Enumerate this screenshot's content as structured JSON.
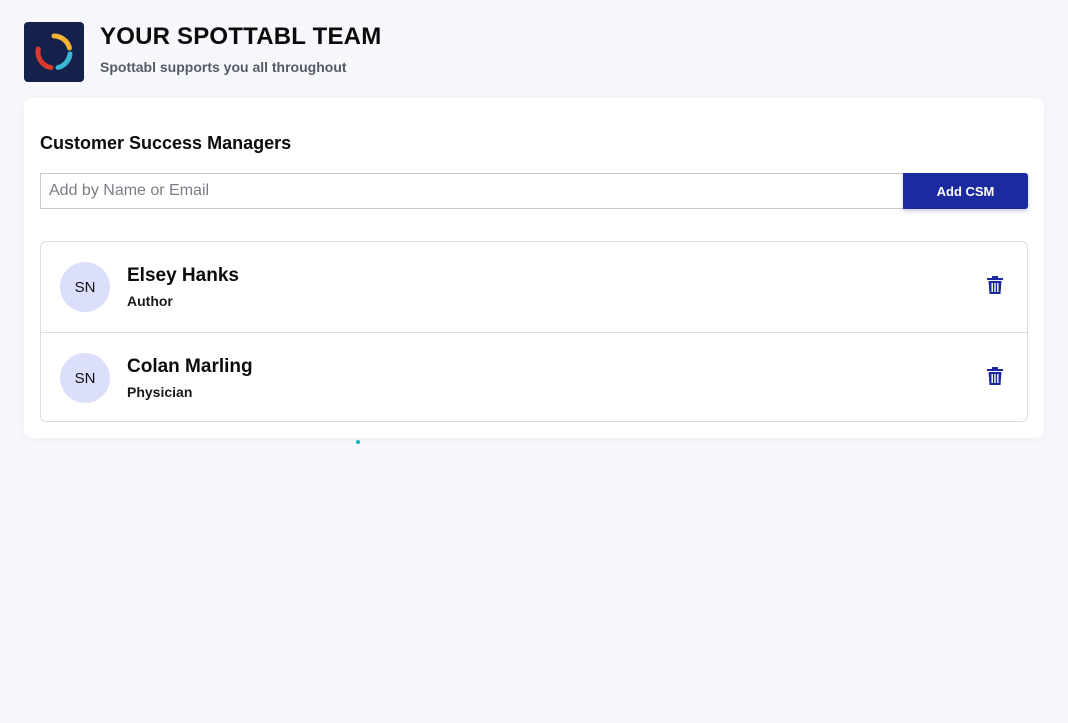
{
  "header": {
    "title": "YOUR SPOTTABL TEAM",
    "subtitle": "Spottabl supports you all throughout",
    "logo_icon": "spottabl-logo-icon"
  },
  "csm": {
    "section_title": "Customer Success Managers",
    "search": {
      "placeholder": "Add by Name or Email",
      "value": ""
    },
    "add_button_label": "Add CSM",
    "members": [
      {
        "initials": "SN",
        "name": "Elsey Hanks",
        "role": "Author",
        "delete_icon": "trash-icon"
      },
      {
        "initials": "SN",
        "name": "Colan Marling",
        "role": "Physician",
        "delete_icon": "trash-icon"
      }
    ]
  },
  "colors": {
    "accent": "#1b2a9e",
    "avatar_bg": "#dcdffb",
    "page_bg": "#f7f8fc",
    "logo_bg": "#14214a"
  }
}
